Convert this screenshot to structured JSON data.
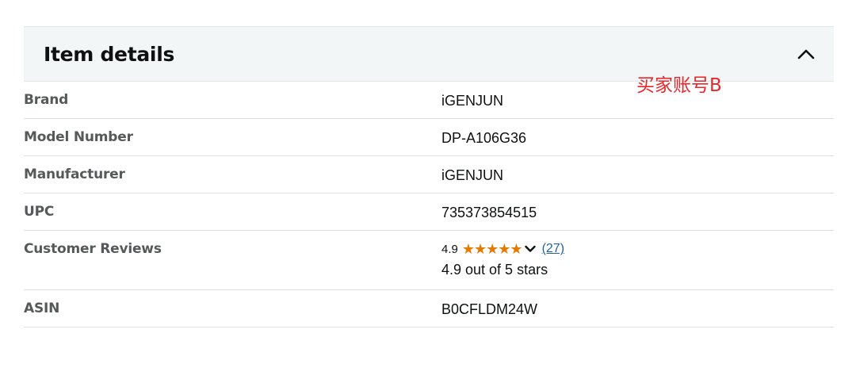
{
  "section": {
    "title": "Item details"
  },
  "annotation": "买家账号B",
  "rows": [
    {
      "label": "Brand",
      "value": "iGENJUN"
    },
    {
      "label": "Model Number",
      "value": "DP-A106G36"
    },
    {
      "label": "Manufacturer",
      "value": "iGENJUN"
    },
    {
      "label": "UPC",
      "value": "735373854515"
    },
    {
      "label": "Customer Reviews",
      "value": ""
    },
    {
      "label": "ASIN",
      "value": "B0CFLDM24W"
    }
  ],
  "reviews": {
    "rating": "4.9",
    "stars_filled": 5,
    "stars_total": 5,
    "count_link": "(27)",
    "rating_text": "4.9 out of 5 stars",
    "star_color": "#e67a00",
    "link_color": "#2162a1"
  },
  "icons": {
    "collapse": "chevron-up-icon",
    "dropdown": "chevron-down-icon",
    "star": "star-icon"
  }
}
